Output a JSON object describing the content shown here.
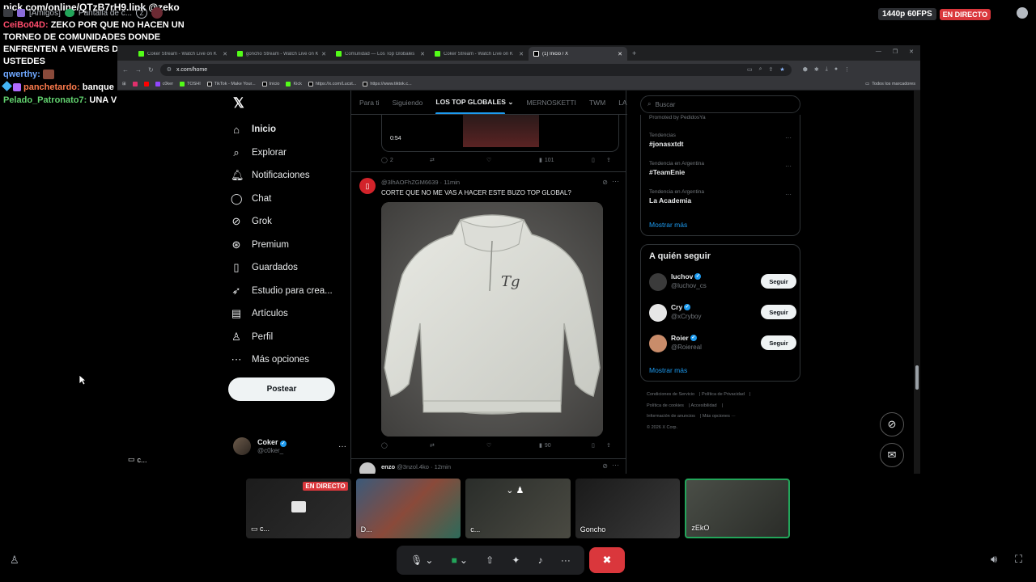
{
  "overlay": {
    "stream_link": "pick.com/online/QTzB7rH9.link @zeko",
    "discord_bar": {
      "channel": "[Amigos]",
      "screen": "Pantalla de c...",
      "z_icon": "Z"
    },
    "chat": [
      {
        "user": "CeiBo04D:",
        "message": "ZEKO POR QUE NO HACEN UN TORNEO DE COMUNIDADES DONDE ENFRENTEN A VIEWERS DE CADA UNO DE USTEDES",
        "color": "#ff4d6d"
      },
      {
        "user": "qwerthy:",
        "message": "",
        "color": "#6fa8ff"
      },
      {
        "user": "panchetardo:",
        "message": "banque",
        "color": "#ff7c4d"
      },
      {
        "user": "Pelado_Patronato7:",
        "message": "UNA VERGA LA IDEA",
        "color": "#62d26f"
      }
    ],
    "quality": "1440p 60FPS",
    "live": "EN DIRECTO"
  },
  "browser": {
    "tabs": [
      {
        "title": "Coker Stream - Watch Live on K",
        "color": "#53fc18",
        "active": false
      },
      {
        "title": "goncho Stream - Watch Live on K",
        "color": "#53fc18",
        "active": false
      },
      {
        "title": "Comunidad — Los Top Globales",
        "color": "#53fc18",
        "active": false
      },
      {
        "title": "Coker Stream - Watch Live on K",
        "color": "#53fc18",
        "active": false
      },
      {
        "title": "(1) Inicio / X",
        "color": "#ffffff",
        "active": true
      }
    ],
    "url": "x.com/home",
    "bookmarks": [
      "c0ker",
      "TOSHI",
      "TikTok - Make Your...",
      "Inicio",
      "Kick",
      "https://x.com/Lucst...",
      "https://www.tiktok.c..."
    ],
    "bookmarks_all": "Todos los marcadores"
  },
  "x": {
    "nav": [
      {
        "label": "Inicio",
        "icon": "home-icon",
        "bold": true
      },
      {
        "label": "Explorar",
        "icon": "search-icon"
      },
      {
        "label": "Notificaciones",
        "icon": "bell-icon"
      },
      {
        "label": "Chat",
        "icon": "chat-icon"
      },
      {
        "label": "Grok",
        "icon": "grok-icon"
      },
      {
        "label": "Premium",
        "icon": "premium-icon"
      },
      {
        "label": "Guardados",
        "icon": "bookmark-icon"
      },
      {
        "label": "Estudio para crea...",
        "icon": "rocket-icon"
      },
      {
        "label": "Artículos",
        "icon": "article-icon"
      },
      {
        "label": "Perfil",
        "icon": "person-icon"
      },
      {
        "label": "Más opciones",
        "icon": "more-icon"
      }
    ],
    "post_button": "Postear",
    "account": {
      "name": "Coker",
      "handle": "@c0ker_"
    },
    "timeline_tabs": [
      "Para ti",
      "Siguiendo",
      "LOS TOP GLOBALES",
      "MERNOSKETTI",
      "TWM",
      "LA"
    ],
    "prev_post": {
      "time": "0:54",
      "replies": "2",
      "likes": "",
      "views": "101"
    },
    "post": {
      "meta": "@3lhAOFhZGM6639 · 11min",
      "text": "CORTE QUE NO ME VAS A HACER ESTE BUZO TOP GLOBAL?",
      "views": "90",
      "image_logo": "Tg"
    },
    "next_post": {
      "name": "enzo",
      "handle": "@3nzol.4ko · 12min"
    },
    "search_placeholder": "Buscar",
    "promoted": "Promoted by PedidosYa",
    "trends": [
      {
        "context": "Tendencias",
        "name": "#jonasxtdt"
      },
      {
        "context": "Tendencia en Argentina",
        "name": "#TeamEnie"
      },
      {
        "context": "Tendencia en Argentina",
        "name": "La Academia"
      }
    ],
    "show_more": "Mostrar más",
    "who_to_follow_title": "A quién seguir",
    "follow": [
      {
        "name": "luchov",
        "handle": "@luchov_cs",
        "button": "Seguir",
        "avatar_color": "#3b3b3b"
      },
      {
        "name": "Cry",
        "handle": "@xCryboy",
        "button": "Seguir",
        "avatar_color": "#e6e6e6"
      },
      {
        "name": "Roier",
        "handle": "@Roiereal",
        "button": "Seguir",
        "avatar_color": "#c98c6a"
      }
    ],
    "footer": [
      "Condiciones de Servicio",
      "Política de Privacidad",
      "Política de cookies",
      "Accesibilidad",
      "Información de anuncios",
      "Más opciones ···",
      "© 2026 X Corp."
    ]
  },
  "discord": {
    "cams": [
      {
        "label": "c...",
        "live": "EN DIRECTO"
      },
      {
        "label": "D..."
      },
      {
        "label": "c..."
      },
      {
        "label": "Goncho"
      },
      {
        "label": "zEkO"
      }
    ],
    "screen_share_label": "c..."
  }
}
